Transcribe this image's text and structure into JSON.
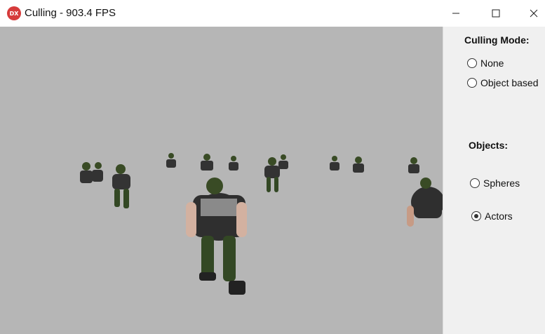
{
  "window": {
    "icon_text": "DX",
    "title": "Culling - 903.4 FPS"
  },
  "panel": {
    "culling_mode_label": "Culling Mode:",
    "culling_options": [
      {
        "label": "None",
        "checked": false
      },
      {
        "label": "Object based",
        "checked": false
      }
    ],
    "objects_label": "Objects:",
    "object_options": [
      {
        "label": "Spheres",
        "checked": false
      },
      {
        "label": "Actors",
        "checked": true
      }
    ]
  },
  "scene": {
    "background_color": "#b6b6b6",
    "content": "3D actor characters rendered on gray background"
  }
}
